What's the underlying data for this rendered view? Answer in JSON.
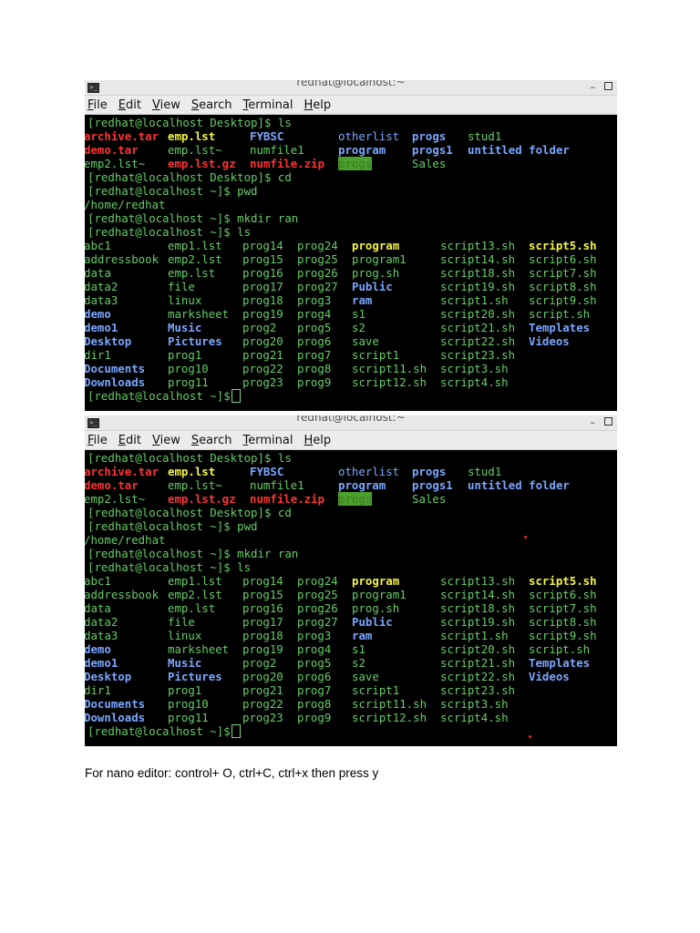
{
  "window": {
    "title": "redhat@localhost:~",
    "menu": [
      {
        "first": "F",
        "rest": "ile"
      },
      {
        "first": "E",
        "rest": "dit"
      },
      {
        "first": "V",
        "rest": "iew"
      },
      {
        "first": "S",
        "rest": "earch"
      },
      {
        "first": "T",
        "rest": "erminal"
      },
      {
        "first": "H",
        "rest": "elp"
      }
    ]
  },
  "terminal_lines": [
    [
      {
        "t": "[redhat@localhost Desktop]$ ls",
        "c": "green"
      }
    ],
    [
      {
        "t": "archive.tar",
        "c": "red b"
      },
      {
        "t": "emp.lst",
        "c": "yellow b"
      },
      {
        "t": "FYBSC",
        "c": "blue b"
      },
      {
        "t": "otherlist",
        "c": "blue"
      },
      {
        "t": "progs",
        "c": "blue b"
      },
      {
        "t": "stud1",
        "c": "green"
      }
    ],
    [
      {
        "t": "demo.tar",
        "c": "red b"
      },
      {
        "t": "emp.lst~",
        "c": "green"
      },
      {
        "t": "numfile1",
        "c": "green"
      },
      {
        "t": "program",
        "c": "blue b"
      },
      {
        "t": "progs1",
        "c": "blue b"
      },
      {
        "t": "untitled folder",
        "c": "blue b"
      }
    ],
    [
      {
        "t": "emp2.lst~",
        "c": "green"
      },
      {
        "t": "emp.lst.gz",
        "c": "red b"
      },
      {
        "t": "numfile.zip",
        "c": "red b"
      },
      {
        "t": "progs",
        "c": "hl"
      },
      {
        "t": "Sales",
        "c": "green"
      }
    ],
    [
      {
        "t": "[redhat@localhost Desktop]$ cd",
        "c": "green"
      }
    ],
    [
      {
        "t": "[redhat@localhost ~]$ pwd",
        "c": "green"
      }
    ],
    [
      {
        "t": "/home/redhat",
        "c": "green"
      }
    ],
    [
      {
        "t": "[redhat@localhost ~]$ mkdir ran",
        "c": "green"
      }
    ],
    [
      {
        "t": "[redhat@localhost ~]$ ls",
        "c": "green"
      }
    ],
    [
      {
        "t": "abc1",
        "c": "green"
      },
      {
        "t": "emp1.lst",
        "c": "green"
      },
      {
        "t": "prog14",
        "c": "green"
      },
      {
        "t": "prog24",
        "c": "green"
      },
      {
        "t": "program",
        "c": "yellow b"
      },
      {
        "t": "script13.sh",
        "c": "green"
      },
      {
        "t": "script5.sh",
        "c": "yellow b"
      }
    ],
    [
      {
        "t": "addressbook",
        "c": "green"
      },
      {
        "t": "emp2.lst",
        "c": "green"
      },
      {
        "t": "prog15",
        "c": "green"
      },
      {
        "t": "prog25",
        "c": "green"
      },
      {
        "t": "program1",
        "c": "green"
      },
      {
        "t": "script14.sh",
        "c": "green"
      },
      {
        "t": "script6.sh",
        "c": "green"
      }
    ],
    [
      {
        "t": "data",
        "c": "green"
      },
      {
        "t": "emp.lst",
        "c": "green"
      },
      {
        "t": "prog16",
        "c": "green"
      },
      {
        "t": "prog26",
        "c": "green"
      },
      {
        "t": "prog.sh",
        "c": "green"
      },
      {
        "t": "script18.sh",
        "c": "green"
      },
      {
        "t": "script7.sh",
        "c": "green"
      }
    ],
    [
      {
        "t": "data2",
        "c": "green"
      },
      {
        "t": "file",
        "c": "green"
      },
      {
        "t": "prog17",
        "c": "green"
      },
      {
        "t": "prog27",
        "c": "green"
      },
      {
        "t": "Public",
        "c": "blue b"
      },
      {
        "t": "script19.sh",
        "c": "green"
      },
      {
        "t": "script8.sh",
        "c": "green"
      }
    ],
    [
      {
        "t": "data3",
        "c": "green"
      },
      {
        "t": "linux",
        "c": "green"
      },
      {
        "t": "prog18",
        "c": "green"
      },
      {
        "t": "prog3",
        "c": "green"
      },
      {
        "t": "ram",
        "c": "blue b"
      },
      {
        "t": "script1.sh",
        "c": "green"
      },
      {
        "t": "script9.sh",
        "c": "green"
      }
    ],
    [
      {
        "t": "demo",
        "c": "blue b"
      },
      {
        "t": "marksheet",
        "c": "green"
      },
      {
        "t": "prog19",
        "c": "green"
      },
      {
        "t": "prog4",
        "c": "green"
      },
      {
        "t": "s1",
        "c": "green"
      },
      {
        "t": "script20.sh",
        "c": "green"
      },
      {
        "t": "script.sh",
        "c": "green"
      }
    ],
    [
      {
        "t": "demo1",
        "c": "blue b"
      },
      {
        "t": "Music",
        "c": "blue b"
      },
      {
        "t": "prog2",
        "c": "green"
      },
      {
        "t": "prog5",
        "c": "green"
      },
      {
        "t": "s2",
        "c": "green"
      },
      {
        "t": "script21.sh",
        "c": "green"
      },
      {
        "t": "Templates",
        "c": "blue b"
      }
    ],
    [
      {
        "t": "Desktop",
        "c": "blue b"
      },
      {
        "t": "Pictures",
        "c": "blue b"
      },
      {
        "t": "prog20",
        "c": "green"
      },
      {
        "t": "prog6",
        "c": "green"
      },
      {
        "t": "save",
        "c": "green"
      },
      {
        "t": "script22.sh",
        "c": "green"
      },
      {
        "t": "Videos",
        "c": "blue b"
      }
    ],
    [
      {
        "t": "dir1",
        "c": "green"
      },
      {
        "t": "prog1",
        "c": "green"
      },
      {
        "t": "prog21",
        "c": "green"
      },
      {
        "t": "prog7",
        "c": "green"
      },
      {
        "t": "script1",
        "c": "green"
      },
      {
        "t": "script23.sh",
        "c": "green"
      }
    ],
    [
      {
        "t": "Documents",
        "c": "blue b"
      },
      {
        "t": "prog10",
        "c": "green"
      },
      {
        "t": "prog22",
        "c": "green"
      },
      {
        "t": "prog8",
        "c": "green"
      },
      {
        "t": "script11.sh",
        "c": "green"
      },
      {
        "t": "script3.sh",
        "c": "green"
      }
    ],
    [
      {
        "t": "Downloads",
        "c": "blue b"
      },
      {
        "t": "prog11",
        "c": "green"
      },
      {
        "t": "prog23",
        "c": "green"
      },
      {
        "t": "prog9",
        "c": "green"
      },
      {
        "t": "script12.sh",
        "c": "green"
      },
      {
        "t": "script4.sh",
        "c": "green"
      }
    ],
    [
      {
        "t": "[redhat@localhost ~]$ ",
        "c": "green"
      }
    ]
  ],
  "caption": "For nano editor: control+ O, ctrl+C, ctrl+x then press y",
  "colors": {
    "terminal_bg": "#000000",
    "prompt_green": "#7fd47f",
    "archive_red": "#ff3333",
    "directory_blue": "#7aa7ff",
    "executable_yellow": "#f5f542"
  }
}
